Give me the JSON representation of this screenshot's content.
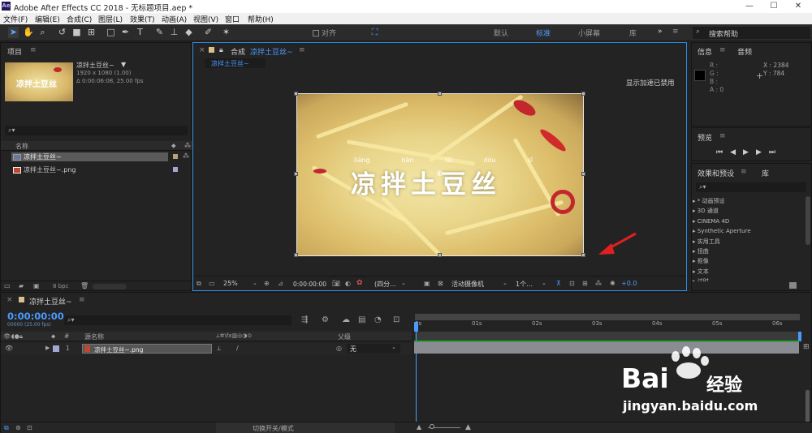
{
  "titlebar": {
    "app_icon": "Ae",
    "title": "Adobe After Effects CC 2018 - 无标题项目.aep *"
  },
  "menu": [
    "文件(F)",
    "编辑(E)",
    "合成(C)",
    "图层(L)",
    "效果(T)",
    "动画(A)",
    "视图(V)",
    "窗口",
    "帮助(H)"
  ],
  "toolbar": {
    "align_label": "对齐",
    "workspaces": [
      "默认",
      "标准",
      "小屏幕",
      "库"
    ],
    "active_workspace": "标准",
    "search_help": "搜索帮助"
  },
  "project": {
    "tab": "项目",
    "comp_name": "凉拌土豆丝~",
    "comp_size": "1920 x 1080 (1.00)",
    "comp_duration": "Δ 0:00:06:08, 25.00 fps",
    "col_name": "名称",
    "items": [
      {
        "name": "凉拌土豆丝~",
        "type": "comp"
      },
      {
        "name": "凉拌土豆丝~.png",
        "type": "image"
      }
    ],
    "bpc": "8 bpc"
  },
  "composition": {
    "tab_prefix": "合成",
    "tab_name": "凉拌土豆丝~",
    "breadcrumb": "凉拌土豆丝~",
    "notice": "显示加速已禁用",
    "pinyin": [
      "liáng",
      "bàn",
      "tǔ",
      "dòu",
      "sī"
    ],
    "title_text": "凉拌土豆丝",
    "zoom": "25%",
    "time": "0:00:00:00",
    "resolution": "(四分…",
    "camera": "活动摄像机",
    "views": "1个…",
    "exposure": "+0.0"
  },
  "info": {
    "tab": "信息",
    "tab2": "音频",
    "labels": [
      "R :",
      "G :",
      "B :",
      "A : 0"
    ],
    "x": "X : 2384",
    "y": "Y : 784"
  },
  "preview": {
    "tab": "预览"
  },
  "effects": {
    "tab": "效果和预设",
    "tab2": "库",
    "items": [
      "* 动画预设",
      "3D 通道",
      "CINEMA 4D",
      "Synthetic Aperture",
      "实用工具",
      "扭曲",
      "抠像",
      "文本",
      "过时"
    ]
  },
  "timeline": {
    "tab": "凉拌土豆丝~",
    "timecode": "0:00:00:00",
    "fps": "00000 (25.00 fps)",
    "col_source": "源名称",
    "col_parent": "父级",
    "layer": {
      "num": "1",
      "name": "凉拌土豆丝~.png",
      "parent": "无"
    },
    "ruler": [
      "0s",
      "01s",
      "02s",
      "03s",
      "04s",
      "05s",
      "06s"
    ],
    "toggle": "切换开关/模式"
  },
  "watermark": {
    "brand": "Bai",
    "brand2": "经验",
    "url": "jingyan.baidu.com"
  }
}
